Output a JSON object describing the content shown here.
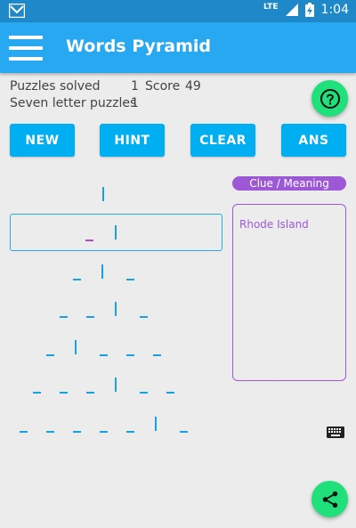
{
  "status_bar": {
    "network": "LTE",
    "time": "1:04"
  },
  "app_bar": {
    "title": "Words Pyramid"
  },
  "stats": {
    "puzzles_solved_label": "Puzzles solved",
    "puzzles_solved_value": "1",
    "score_label": "Score",
    "score_value": "49",
    "seven_letter_label": "Seven letter puzzles",
    "seven_letter_value": "1"
  },
  "buttons": {
    "new": "NEW",
    "hint": "HINT",
    "clear": "CLEAR",
    "ans": "ANS"
  },
  "clue": {
    "header": "Clue / Meaning",
    "text": "Rhode Island"
  },
  "colors": {
    "accent": "#29a8f2",
    "button": "#00aef2",
    "fab": "#1fe07b",
    "clue": "#9d58d6"
  },
  "icons": {
    "help": "help-circle-icon",
    "keyboard": "keyboard-icon",
    "share": "share-icon",
    "menu": "hamburger-icon"
  }
}
